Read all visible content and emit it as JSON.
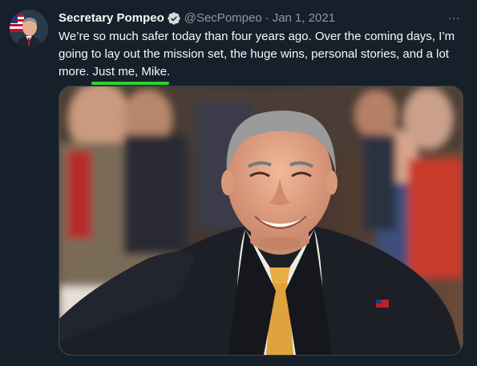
{
  "tweet": {
    "author_name": "Secretary Pompeo",
    "handle": "@SecPompeo",
    "separator": "·",
    "date": "Jan 1, 2021",
    "more_label": "···",
    "text_before": "We’re so much safer today than four years ago. Over the coming days, I’m going to lay out the mission set, the huge wins, personal stories, and a lot more. ",
    "text_highlight": "Just me, Mike",
    "text_after": "."
  },
  "colors": {
    "background": "#15202b",
    "primary_text": "#f7f9f9",
    "secondary_text": "#8b98a5",
    "verified_badge": "#d9d9d9",
    "highlight_underline": "#2fd12f"
  },
  "icons": {
    "verified": "verified-badge-icon",
    "more": "more-dots-icon"
  }
}
